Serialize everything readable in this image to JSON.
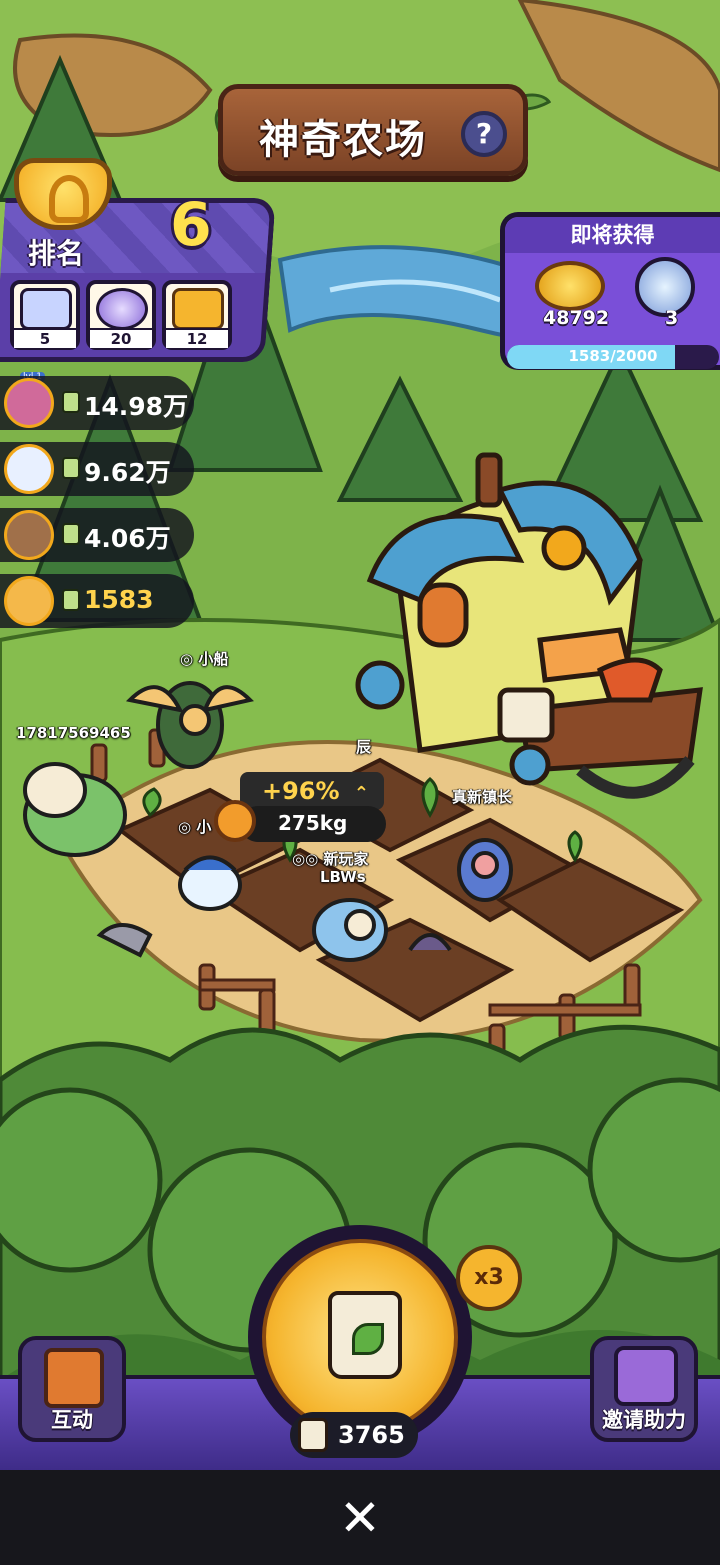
{
  "header": {
    "title": "神奇农场",
    "help_icon": "?"
  },
  "rank": {
    "label": "排名",
    "value": "6",
    "items": [
      {
        "icon": "mystery-box-icon",
        "count": "5"
      },
      {
        "icon": "capsule-icon",
        "count": "20"
      },
      {
        "icon": "ticket-icon",
        "count": "12"
      }
    ]
  },
  "leaderboard": [
    {
      "level": "lvl.1",
      "score": "14.98万"
    },
    {
      "score": "9.62万"
    },
    {
      "score": "4.06万"
    },
    {
      "score": "1583"
    }
  ],
  "reward": {
    "title": "即将获得",
    "gold": "48792",
    "capsules": "3",
    "progress_text": "1583/2000",
    "progress_fraction": 0.7915
  },
  "scene": {
    "players": [
      "小船",
      "17817569465",
      "小",
      "新玩家",
      "LBWs",
      "真新镇长",
      "辰"
    ],
    "boost": "+96%",
    "weight": "275kg"
  },
  "actions": {
    "interact": "互动",
    "invite": "邀请助力",
    "multiplier": "x3",
    "seed_count": "3765"
  },
  "dock": {
    "close": "✕"
  },
  "colors": {
    "panel_purple": "#5b3fa8",
    "accent_gold": "#ffd34d",
    "wood": "#7c4326"
  }
}
